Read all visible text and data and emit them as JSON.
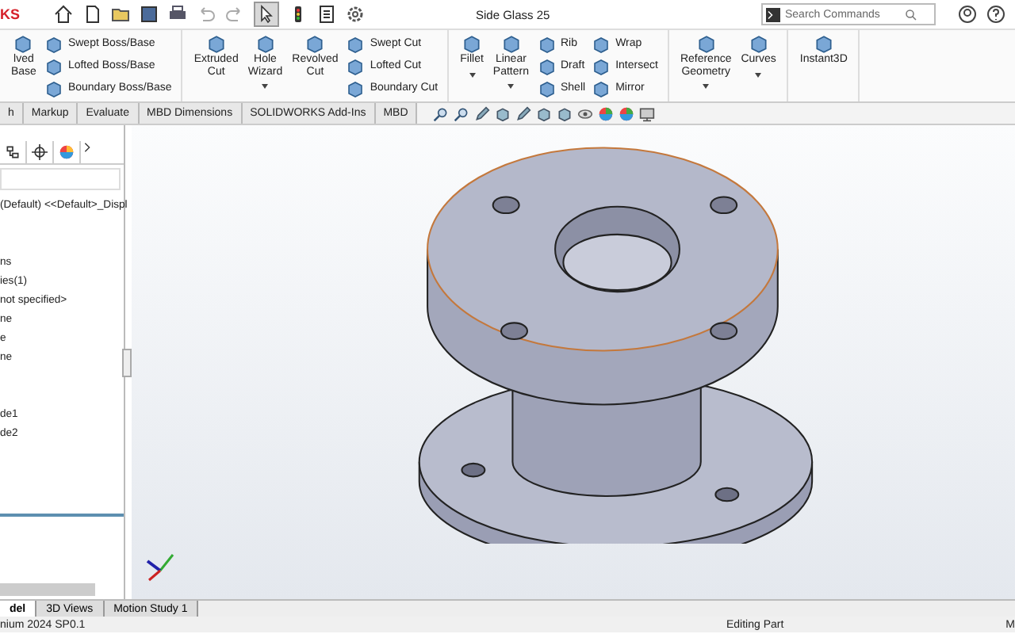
{
  "app_logo": "KS",
  "window": {
    "title": "Side Glass 25"
  },
  "search": {
    "placeholder": "Search Commands"
  },
  "ribbon": {
    "groups": [
      {
        "items": [
          {
            "kind": "large",
            "label": "lved Base",
            "dropdown": false
          },
          {
            "kind": "stack",
            "labels": [
              "Swept Boss/Base",
              "Lofted Boss/Base",
              "Boundary Boss/Base"
            ]
          }
        ]
      },
      {
        "items": [
          {
            "kind": "large",
            "label": "Extruded Cut",
            "dropdown": false
          },
          {
            "kind": "large",
            "label": "Hole Wizard",
            "dropdown": true
          },
          {
            "kind": "large",
            "label": "Revolved Cut",
            "dropdown": false
          },
          {
            "kind": "stack",
            "labels": [
              "Swept Cut",
              "Lofted Cut",
              "Boundary Cut"
            ]
          }
        ]
      },
      {
        "items": [
          {
            "kind": "large",
            "label": "Fillet",
            "dropdown": true
          },
          {
            "kind": "large",
            "label": "Linear Pattern",
            "dropdown": true
          },
          {
            "kind": "stack",
            "labels": [
              "Rib",
              "Draft",
              "Shell"
            ]
          },
          {
            "kind": "stack",
            "labels": [
              "Wrap",
              "Intersect",
              "Mirror"
            ]
          }
        ]
      },
      {
        "items": [
          {
            "kind": "large",
            "label": "Reference Geometry",
            "dropdown": true
          },
          {
            "kind": "large",
            "label": "Curves",
            "dropdown": true
          }
        ]
      },
      {
        "items": [
          {
            "kind": "large",
            "label": "Instant3D",
            "dropdown": false
          }
        ]
      }
    ]
  },
  "command_tabs": [
    {
      "label": "h",
      "selected": false
    },
    {
      "label": "Markup",
      "selected": false
    },
    {
      "label": "Evaluate",
      "selected": false
    },
    {
      "label": "MBD Dimensions",
      "selected": false
    },
    {
      "label": "SOLIDWORKS Add-Ins",
      "selected": false
    },
    {
      "label": "MBD",
      "selected": false
    }
  ],
  "feature_tree": {
    "items": [
      "(Default) <<Default>_Displ",
      "ns",
      "ies(1)",
      "not specified>",
      "ne",
      "e",
      "ne",
      "de1",
      "de2"
    ]
  },
  "bottom_tabs": [
    {
      "label": "del",
      "selected": true
    },
    {
      "label": "3D Views",
      "selected": false
    },
    {
      "label": "Motion Study 1",
      "selected": false
    }
  ],
  "status_bar": {
    "version": "nium 2024 SP0.1",
    "mode": "Editing Part",
    "units": "M"
  }
}
